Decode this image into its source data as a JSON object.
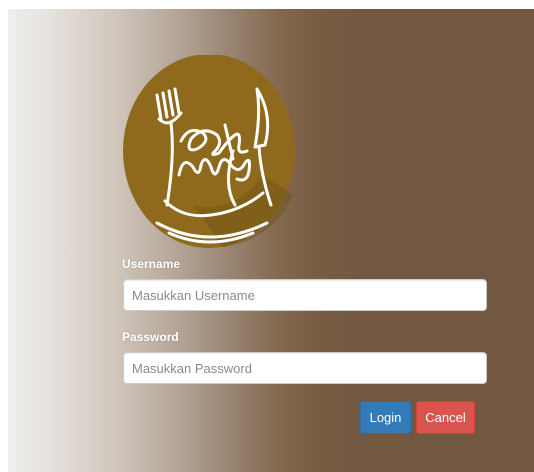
{
  "brand": {
    "logo_text": "eat me",
    "logo_color": "#8f6a1d",
    "icon": "fork-icon"
  },
  "form": {
    "username_label": "Username",
    "username_placeholder": "Masukkan Username",
    "username_value": "",
    "password_label": "Password",
    "password_placeholder": "Masukkan Password",
    "password_value": "",
    "login_label": "Login",
    "cancel_label": "Cancel"
  },
  "colors": {
    "login_button": "#337ab7",
    "cancel_button": "#d9534f",
    "panel_brown": "#735841"
  }
}
